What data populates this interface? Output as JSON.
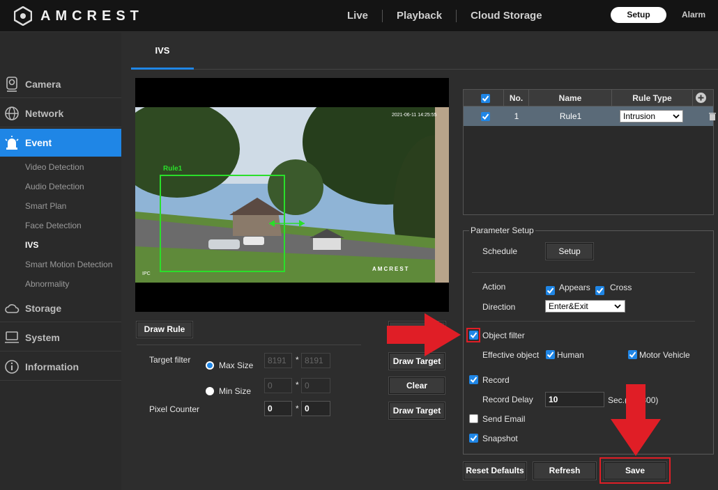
{
  "brand": {
    "name": "AMCREST"
  },
  "nav": {
    "items": [
      "Live",
      "Playback",
      "Cloud Storage"
    ],
    "setup": "Setup",
    "alarm": "Alarm"
  },
  "sidebar": {
    "camera": "Camera",
    "network": "Network",
    "event": "Event",
    "sub": [
      "Video Detection",
      "Audio Detection",
      "Smart Plan",
      "Face Detection",
      "IVS",
      "Smart Motion Detection",
      "Abnormality"
    ],
    "storage": "Storage",
    "system": "System",
    "information": "Information"
  },
  "tab": {
    "label": "IVS"
  },
  "video": {
    "timestamp": "2021-06-11 14:25:55",
    "rule_label": "Rule1",
    "channel": "IPC",
    "watermark": "AMCREST"
  },
  "left": {
    "draw_rule": "Draw Rule",
    "target_filter": "Target filter",
    "max_size": "Max Size",
    "min_size": "Min Size",
    "max_w": "8191",
    "max_h": "8191",
    "min_w": "0",
    "min_h": "0",
    "pixel_counter": "Pixel Counter",
    "pix_w": "0",
    "pix_h": "0",
    "times": "*",
    "draw_target_1": "Draw Target",
    "clear": "Clear",
    "draw_target_2": "Draw Target"
  },
  "rules": {
    "headers": {
      "no": "No.",
      "name": "Name",
      "type": "Rule Type"
    },
    "rows": [
      {
        "no": "1",
        "name": "Rule1",
        "type": "Intrusion"
      }
    ]
  },
  "params": {
    "title": "Parameter Setup",
    "schedule": "Schedule",
    "schedule_btn": "Setup",
    "action": "Action",
    "appears": "Appears",
    "cross": "Cross",
    "direction": "Direction",
    "direction_value": "Enter&Exit",
    "object_filter": "Object filter",
    "effective_object": "Effective object",
    "human": "Human",
    "motor_vehicle": "Motor Vehicle",
    "record": "Record",
    "record_delay": "Record Delay",
    "record_delay_value": "10",
    "record_delay_unit": "Sec.(10~300)",
    "send_email": "Send Email",
    "snapshot": "Snapshot"
  },
  "footer": {
    "reset": "Reset Defaults",
    "refresh": "Refresh",
    "save": "Save"
  },
  "colors": {
    "accent": "#1f86e6",
    "highlight": "#e01e26",
    "rule_green": "#2adf2a"
  }
}
